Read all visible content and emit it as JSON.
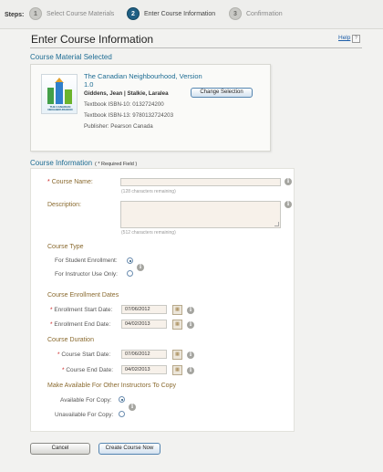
{
  "steps": {
    "label": "Steps:",
    "items": [
      {
        "number": "1",
        "label": "Select Course Materials",
        "state": "inactive"
      },
      {
        "number": "2",
        "label": "Enter Course Information",
        "state": "active"
      },
      {
        "number": "3",
        "label": "Confirmation",
        "state": "inactive"
      }
    ]
  },
  "page": {
    "title": "Enter Course Information",
    "help_link": "Help",
    "help_icon_glyph": "?"
  },
  "material": {
    "section_title": "Course Material Selected",
    "cover_text": "THE CANADIAN NEIGHBOURHOOD",
    "book_title": "The Canadian Neighbourhood, Version 1.0",
    "authors": "Giddens, Jean | Stalkie, Laralea",
    "isbn10": "Textbook ISBN-10: 0132724200",
    "isbn13": "Textbook ISBN-13: 9780132724203",
    "publisher": "Publisher: Pearson Canada",
    "change_button": "Change Selection"
  },
  "course_info": {
    "section_title": "Course Information",
    "required_note": "( * Required Field )",
    "required_star": "*",
    "course_name_label": "Course Name:",
    "course_name_value": "",
    "course_name_hint": "(128 characters remaining)",
    "description_label": "Description:",
    "description_value": "",
    "description_hint": "(512 characters remaining)",
    "course_type_title": "Course Type",
    "student_enrollment_label": "For Student Enrollment:",
    "instructor_use_label": "For Instructor Use Only:",
    "enrollment_dates_title": "Course Enrollment Dates",
    "enrollment_start_label": "Enrollment Start Date:",
    "enrollment_start_value": "07/06/2012",
    "enrollment_end_label": "Enrollment End Date:",
    "enrollment_end_value": "04/02/2013",
    "duration_title": "Course Duration",
    "course_start_label": "Course Start Date:",
    "course_start_value": "07/06/2012",
    "course_end_label": "Course End Date:",
    "course_end_value": "04/02/2013",
    "availability_title": "Make Available For Other Instructors To Copy",
    "available_label": "Available For Copy:",
    "unavailable_label": "Unavailable For Copy:",
    "info_glyph": "i"
  },
  "actions": {
    "cancel": "Cancel",
    "create": "Create Course Now"
  },
  "colors": {
    "accent": "#1d6c93",
    "field_label": "#8a6a2f",
    "required": "#cc2222"
  }
}
